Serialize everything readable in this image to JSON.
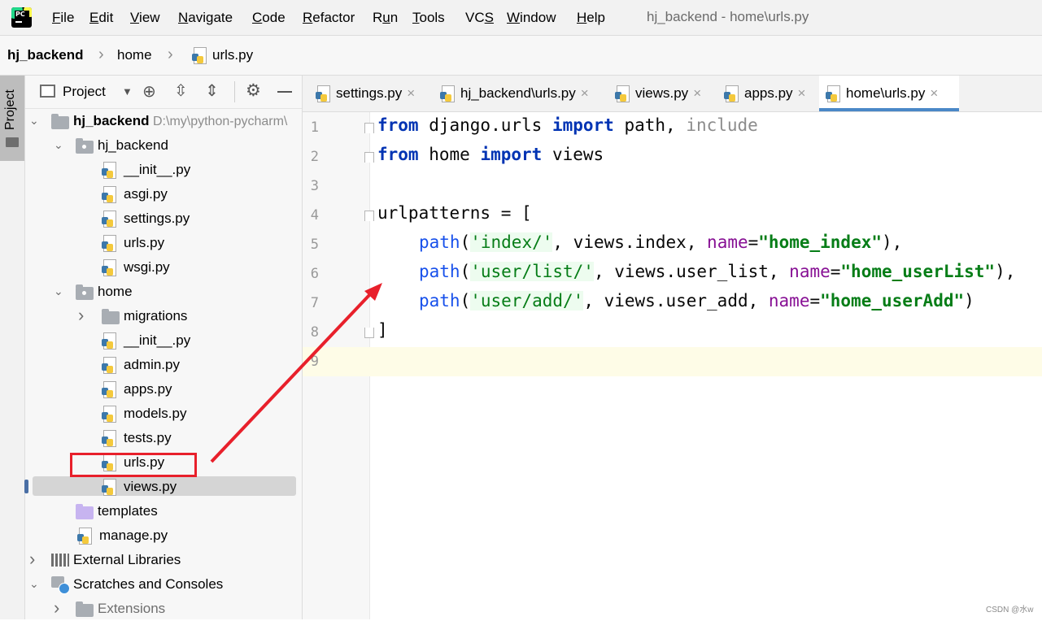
{
  "menu": {
    "items": [
      {
        "label": "File",
        "u": "F",
        "rest": "ile"
      },
      {
        "label": "Edit",
        "u": "E",
        "rest": "dit"
      },
      {
        "label": "View",
        "u": "V",
        "rest": "iew"
      },
      {
        "label": "Navigate",
        "u": "N",
        "rest": "avigate"
      },
      {
        "label": "Code",
        "u": "C",
        "rest": "ode"
      },
      {
        "label": "Refactor",
        "u": "R",
        "rest": "efactor"
      },
      {
        "label": "Run",
        "pre": "R",
        "u": "u",
        "rest": "n"
      },
      {
        "label": "Tools",
        "u": "T",
        "rest": "ools"
      },
      {
        "label": "VCS",
        "pre": "VC",
        "u": "S",
        "rest": ""
      },
      {
        "label": "Window",
        "u": "W",
        "rest": "indow"
      },
      {
        "label": "Help",
        "u": "H",
        "rest": "elp"
      }
    ],
    "window_title": "hj_backend - home\\urls.py",
    "logo_text": "PC"
  },
  "breadcrumb": [
    "hj_backend",
    "home",
    "urls.py"
  ],
  "left_strip": {
    "label": "Project"
  },
  "project_panel": {
    "dropdown_label": "Project",
    "tree": [
      {
        "label": "hj_backend",
        "hint": "D:\\my\\python-pycharm\\",
        "bold": true
      },
      {
        "label": "hj_backend"
      },
      {
        "label": "__init__.py"
      },
      {
        "label": "asgi.py"
      },
      {
        "label": "settings.py"
      },
      {
        "label": "urls.py"
      },
      {
        "label": "wsgi.py"
      },
      {
        "label": "home"
      },
      {
        "label": "migrations"
      },
      {
        "label": "__init__.py"
      },
      {
        "label": "admin.py"
      },
      {
        "label": "apps.py"
      },
      {
        "label": "models.py"
      },
      {
        "label": "tests.py"
      },
      {
        "label": "urls.py"
      },
      {
        "label": "views.py"
      },
      {
        "label": "templates"
      },
      {
        "label": "manage.py"
      },
      {
        "label": "External Libraries"
      },
      {
        "label": "Scratches and Consoles"
      },
      {
        "label": "Extensions"
      }
    ]
  },
  "tabs": [
    {
      "label": "settings.py"
    },
    {
      "label": "hj_backend\\urls.py"
    },
    {
      "label": "views.py"
    },
    {
      "label": "apps.py"
    },
    {
      "label": "home\\urls.py",
      "active": true
    }
  ],
  "editor": {
    "line_numbers": [
      "1",
      "2",
      "3",
      "4",
      "5",
      "6",
      "7",
      "8",
      "9"
    ],
    "code_tokens": {
      "l1": [
        "from",
        " django.urls ",
        "import",
        " path, ",
        "include"
      ],
      "l2": [
        "from",
        " home ",
        "import",
        " views"
      ],
      "l4": [
        "urlpatterns = ["
      ],
      "l5": [
        "path",
        "(",
        "'index/'",
        ", views.index, ",
        "name",
        "=",
        "\"home_index\"",
        "),"
      ],
      "l6": [
        "path",
        "(",
        "'user/list/'",
        ", views.user_list, ",
        "name",
        "=",
        "\"home_userList\"",
        "),"
      ],
      "l7": [
        "path",
        "(",
        "'user/add/'",
        ", views.user_add, ",
        "name",
        "=",
        "\"home_userAdd\"",
        ")"
      ],
      "l8": [
        "]"
      ]
    }
  },
  "colors": {
    "keyword": "#0033b3",
    "function": "#1750eb",
    "string": "#067d17",
    "param": "#871094",
    "annotation": "#e8202b",
    "tab_underline": "#4a88c7"
  },
  "watermark": "CSDN @水w"
}
